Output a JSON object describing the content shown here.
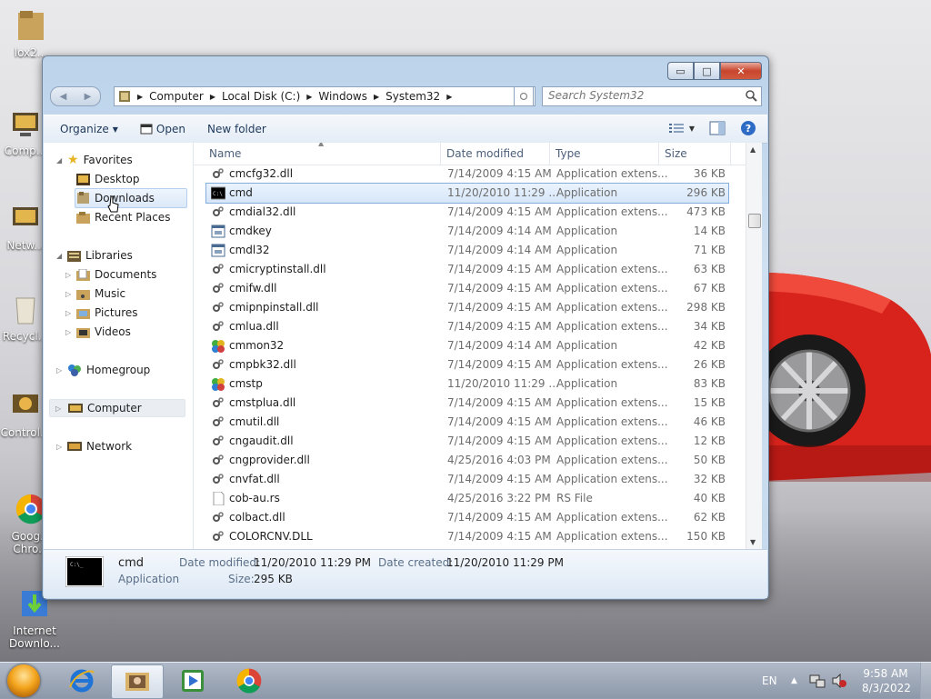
{
  "desktop": {
    "icons": [
      {
        "label": "lox2..."
      },
      {
        "label": "Comp..."
      },
      {
        "label": "Netw..."
      },
      {
        "label": "Recycl..."
      },
      {
        "label": "Control..."
      },
      {
        "label": "Goog...\nChro..."
      },
      {
        "label": "Internet\nDownlo..."
      }
    ]
  },
  "window": {
    "caption_buttons": {
      "minimize": "▭",
      "maximize": "□",
      "close": "✕"
    },
    "nav": {
      "back": "◀",
      "forward": "▶"
    },
    "address": {
      "crumbs": [
        "Computer",
        "Local Disk (C:)",
        "Windows",
        "System32"
      ]
    },
    "search": {
      "placeholder": "Search System32"
    },
    "toolbar": {
      "organize": "Organize",
      "open": "Open",
      "new_folder": "New folder"
    },
    "nav_pane": {
      "favorites": "Favorites",
      "fav_items": [
        "Desktop",
        "Downloads",
        "Recent Places"
      ],
      "libraries": "Libraries",
      "lib_items": [
        "Documents",
        "Music",
        "Pictures",
        "Videos"
      ],
      "homegroup": "Homegroup",
      "computer": "Computer",
      "network": "Network"
    },
    "columns": {
      "name": "Name",
      "date": "Date modified",
      "type": "Type",
      "size": "Size"
    },
    "files": [
      {
        "name": "cmcfg32.dll",
        "date": "7/14/2009 4:15 AM",
        "type": "Application extens...",
        "size": "36 KB",
        "icon": "dll-icon"
      },
      {
        "name": "cmd",
        "date": "11/20/2010 11:29 ...",
        "type": "Application",
        "size": "296 KB",
        "icon": "cmd-icon"
      },
      {
        "name": "cmdial32.dll",
        "date": "7/14/2009 4:15 AM",
        "type": "Application extens...",
        "size": "473 KB",
        "icon": "dll-icon"
      },
      {
        "name": "cmdkey",
        "date": "7/14/2009 4:14 AM",
        "type": "Application",
        "size": "14 KB",
        "icon": "app-icon"
      },
      {
        "name": "cmdl32",
        "date": "7/14/2009 4:14 AM",
        "type": "Application",
        "size": "71 KB",
        "icon": "app-icon"
      },
      {
        "name": "cmicryptinstall.dll",
        "date": "7/14/2009 4:15 AM",
        "type": "Application extens...",
        "size": "63 KB",
        "icon": "dll-icon"
      },
      {
        "name": "cmifw.dll",
        "date": "7/14/2009 4:15 AM",
        "type": "Application extens...",
        "size": "67 KB",
        "icon": "dll-icon"
      },
      {
        "name": "cmipnpinstall.dll",
        "date": "7/14/2009 4:15 AM",
        "type": "Application extens...",
        "size": "298 KB",
        "icon": "dll-icon"
      },
      {
        "name": "cmlua.dll",
        "date": "7/14/2009 4:15 AM",
        "type": "Application extens...",
        "size": "34 KB",
        "icon": "dll-icon"
      },
      {
        "name": "cmmon32",
        "date": "7/14/2009 4:14 AM",
        "type": "Application",
        "size": "42 KB",
        "icon": "green-app-icon"
      },
      {
        "name": "cmpbk32.dll",
        "date": "7/14/2009 4:15 AM",
        "type": "Application extens...",
        "size": "26 KB",
        "icon": "dll-icon"
      },
      {
        "name": "cmstp",
        "date": "11/20/2010 11:29 ...",
        "type": "Application",
        "size": "83 KB",
        "icon": "green-app-icon"
      },
      {
        "name": "cmstplua.dll",
        "date": "7/14/2009 4:15 AM",
        "type": "Application extens...",
        "size": "15 KB",
        "icon": "dll-icon"
      },
      {
        "name": "cmutil.dll",
        "date": "7/14/2009 4:15 AM",
        "type": "Application extens...",
        "size": "46 KB",
        "icon": "dll-icon"
      },
      {
        "name": "cngaudit.dll",
        "date": "7/14/2009 4:15 AM",
        "type": "Application extens...",
        "size": "12 KB",
        "icon": "dll-icon"
      },
      {
        "name": "cngprovider.dll",
        "date": "4/25/2016 4:03 PM",
        "type": "Application extens...",
        "size": "50 KB",
        "icon": "dll-icon"
      },
      {
        "name": "cnvfat.dll",
        "date": "7/14/2009 4:15 AM",
        "type": "Application extens...",
        "size": "32 KB",
        "icon": "dll-icon"
      },
      {
        "name": "cob-au.rs",
        "date": "4/25/2016 3:22 PM",
        "type": "RS File",
        "size": "40 KB",
        "icon": "file-icon"
      },
      {
        "name": "colbact.dll",
        "date": "7/14/2009 4:15 AM",
        "type": "Application extens...",
        "size": "62 KB",
        "icon": "dll-icon"
      },
      {
        "name": "COLORCNV.DLL",
        "date": "7/14/2009 4:15 AM",
        "type": "Application extens...",
        "size": "150 KB",
        "icon": "dll-icon"
      }
    ],
    "selected_index": 1,
    "details": {
      "name": "cmd",
      "type": "Application",
      "date_modified_label": "Date modified:",
      "date_modified": "11/20/2010 11:29 PM",
      "date_created_label": "Date created:",
      "date_created": "11/20/2010 11:29 PM",
      "size_label": "Size:",
      "size": "295 KB"
    }
  },
  "taskbar": {
    "language": "EN",
    "time": "9:58 AM",
    "date": "8/3/2022"
  }
}
